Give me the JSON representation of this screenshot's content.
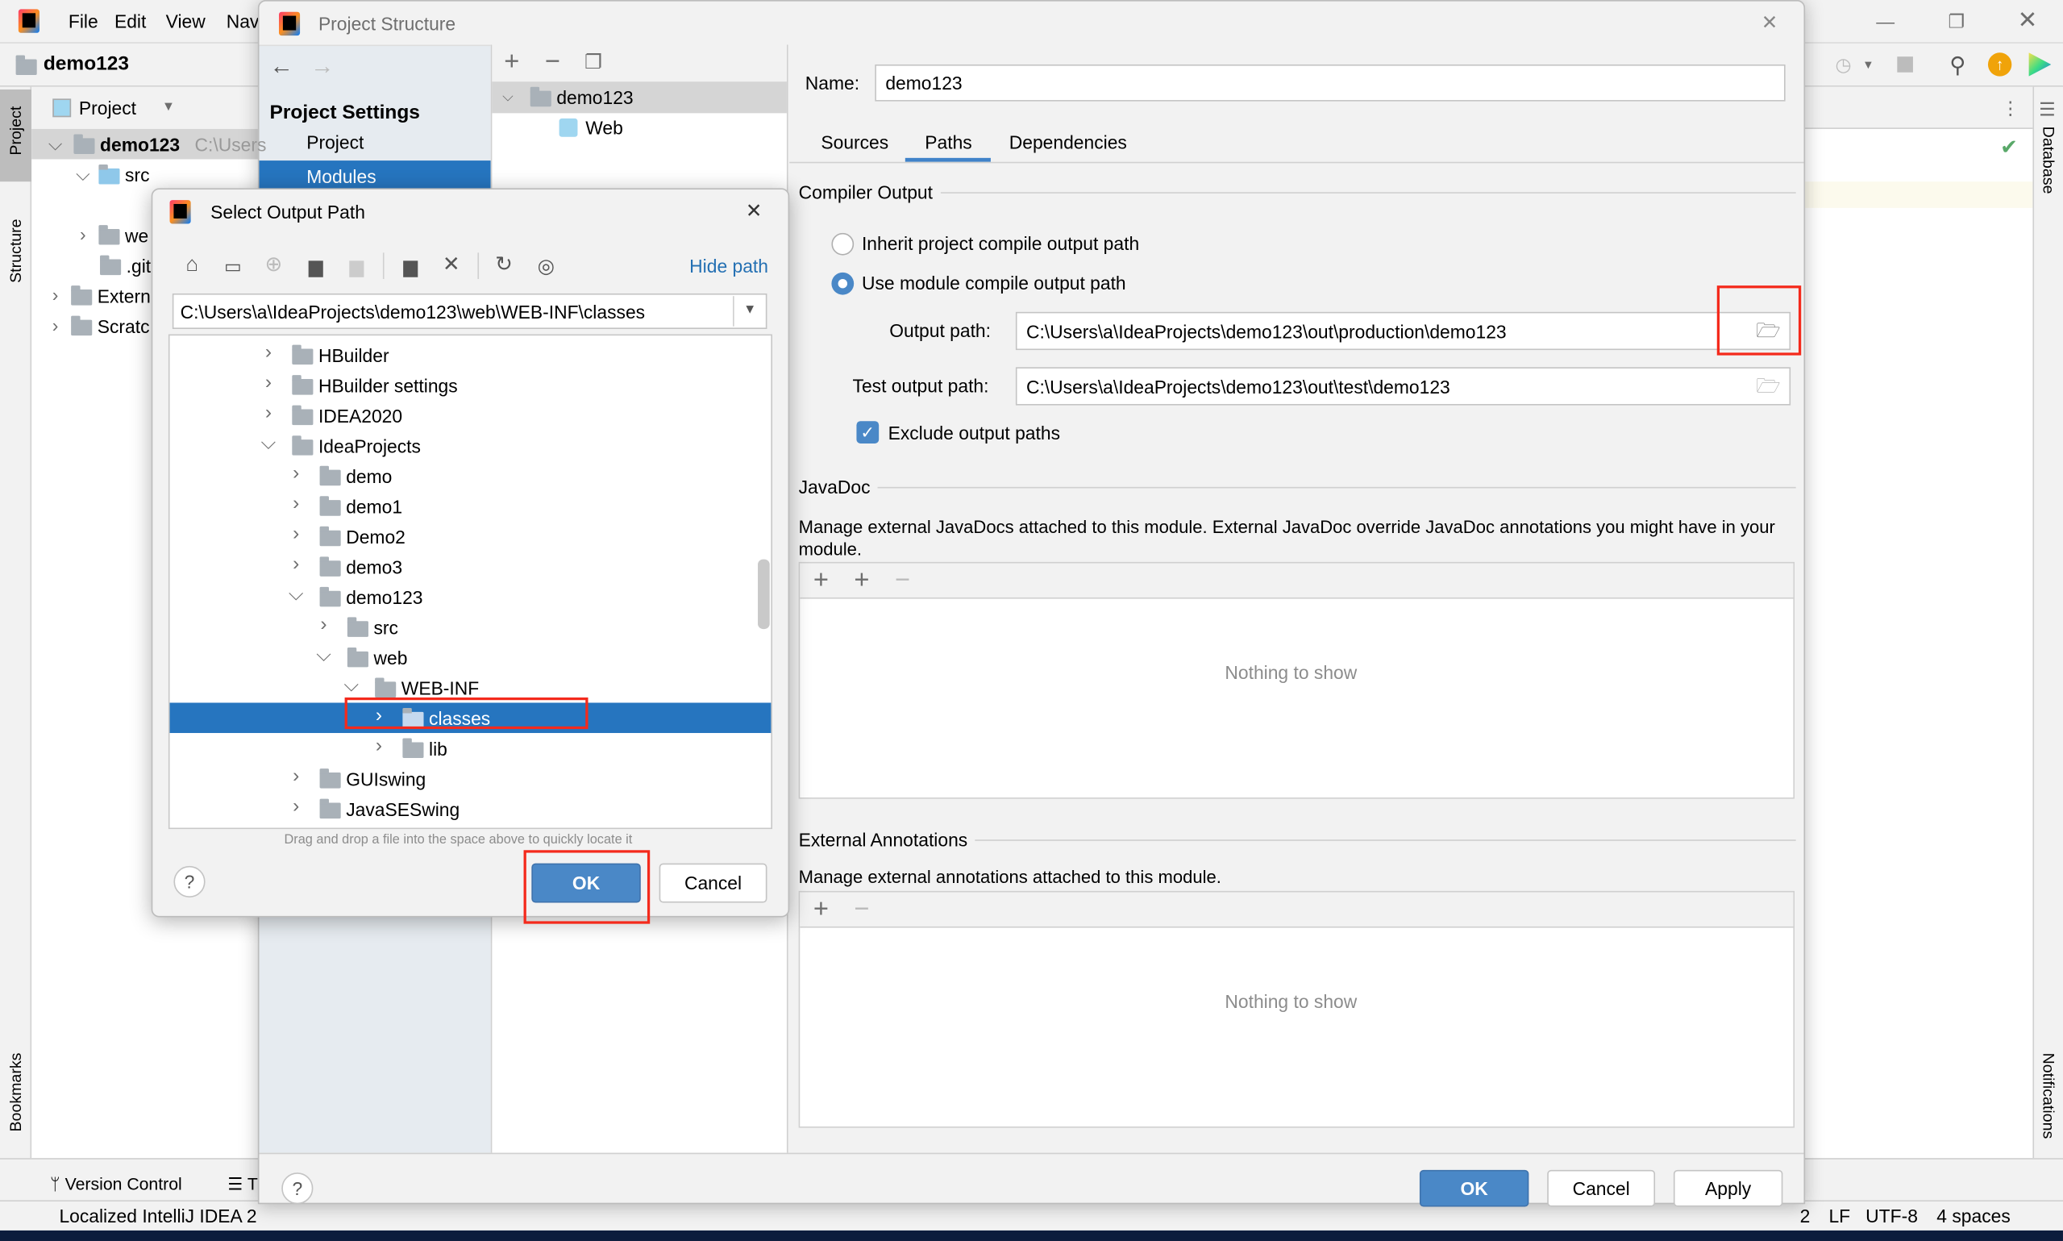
{
  "ide": {
    "menu": [
      "File",
      "Edit",
      "View",
      "Nav"
    ],
    "project_name": "demo123",
    "project_view_label": "Project",
    "tree": [
      {
        "label": "demo123",
        "suffix": "C:\\Users",
        "chevron": "v"
      },
      {
        "label": "src",
        "chevron": "v"
      },
      {
        "label": "we",
        "chevron": ">"
      },
      {
        "label": ".git",
        "chevron": ""
      },
      {
        "label": "Extern",
        "chevron": ">"
      },
      {
        "label": "Scratc",
        "chevron": ">"
      }
    ],
    "left_stripe": [
      "Project",
      "Structure",
      "Bookmarks"
    ],
    "right_stripe": [
      "Database",
      "Notifications"
    ],
    "bottom_tabs": [
      "Version Control",
      "T"
    ],
    "status_text": "Localized IntelliJ IDEA 2",
    "status_right": [
      "2",
      "LF",
      "UTF-8",
      "4 spaces"
    ],
    "accent": "#2675bf"
  },
  "project_structure": {
    "title": "Project Structure",
    "sidebar_heading": "Project Settings",
    "sidebar_items": [
      "Project",
      "Modules"
    ],
    "selected_sidebar": "Modules",
    "module_tree": [
      "demo123",
      "Web"
    ],
    "name_label": "Name:",
    "name_value": "demo123",
    "tabs": [
      "Sources",
      "Paths",
      "Dependencies"
    ],
    "active_tab": "Paths",
    "compiler_output": {
      "title": "Compiler Output",
      "radio_inherit": "Inherit project compile output path",
      "radio_module": "Use module compile output path",
      "selected": "module",
      "output_label": "Output path:",
      "output_value": "C:\\Users\\a\\IdeaProjects\\demo123\\out\\production\\demo123",
      "test_label": "Test output path:",
      "test_value": "C:\\Users\\a\\IdeaProjects\\demo123\\out\\test\\demo123",
      "exclude_label": "Exclude output paths",
      "exclude_checked": true
    },
    "javadoc": {
      "title": "JavaDoc",
      "description": "Manage external JavaDocs attached to this module. External JavaDoc override JavaDoc annotations you might have in your module.",
      "empty": "Nothing to show"
    },
    "annotations": {
      "title": "External Annotations",
      "description": "Manage external annotations attached to this module.",
      "empty": "Nothing to show"
    },
    "ok": "OK",
    "cancel": "Cancel",
    "apply": "Apply",
    "help": "?"
  },
  "select_output": {
    "title": "Select Output Path",
    "hide_path": "Hide path",
    "path_value": "C:\\Users\\a\\IdeaProjects\\demo123\\web\\WEB-INF\\classes",
    "rows": [
      {
        "label": "HBuilder",
        "level": 1,
        "expanded": false
      },
      {
        "label": "HBuilder settings",
        "level": 1,
        "expanded": false
      },
      {
        "label": "IDEA2020",
        "level": 1,
        "expanded": false
      },
      {
        "label": "IdeaProjects",
        "level": 1,
        "expanded": true
      },
      {
        "label": "demo",
        "level": 2,
        "expanded": false
      },
      {
        "label": "demo1",
        "level": 2,
        "expanded": false
      },
      {
        "label": "Demo2",
        "level": 2,
        "expanded": false
      },
      {
        "label": "demo3",
        "level": 2,
        "expanded": false
      },
      {
        "label": "demo123",
        "level": 2,
        "expanded": true
      },
      {
        "label": "src",
        "level": 3,
        "expanded": false
      },
      {
        "label": "web",
        "level": 3,
        "expanded": true
      },
      {
        "label": "WEB-INF",
        "level": 4,
        "expanded": true
      },
      {
        "label": "classes",
        "level": 5,
        "expanded": false,
        "selected": true
      },
      {
        "label": "lib",
        "level": 5,
        "expanded": false
      },
      {
        "label": "GUIswing",
        "level": 2,
        "expanded": false
      },
      {
        "label": "JavaSESwing",
        "level": 2,
        "expanded": false
      }
    ],
    "hint": "Drag and drop a file into the space above to quickly locate it",
    "ok": "OK",
    "cancel": "Cancel",
    "help": "?",
    "highlight_color": "#f42a1c"
  }
}
